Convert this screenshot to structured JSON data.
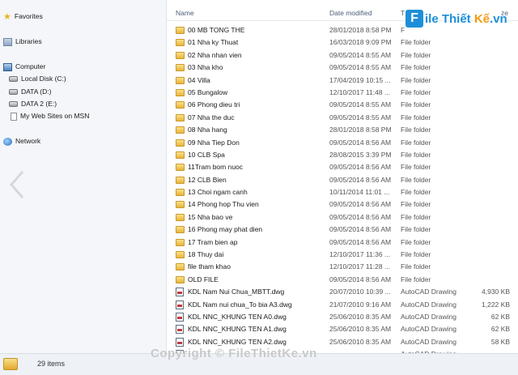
{
  "navigation": {
    "favorites": "Favorites",
    "libraries": "Libraries",
    "computer": "Computer",
    "drives": [
      "Local Disk (C:)",
      "DATA (D:)",
      "DATA 2 (E:)",
      "My Web Sites on MSN"
    ],
    "network": "Network"
  },
  "columns": {
    "name": "Name",
    "date": "Date modified",
    "type": "T",
    "size": "ze"
  },
  "files": [
    {
      "name": "00 MB TONG THE",
      "date": "28/01/2018 8:58 PM",
      "type": "F",
      "size": "",
      "kind": "folder"
    },
    {
      "name": "01 Nha ky Thuat",
      "date": "16/03/2018 9:09 PM",
      "type": "File folder",
      "size": "",
      "kind": "folder"
    },
    {
      "name": "02 Nha nhan vien",
      "date": "09/05/2014 8:55 AM",
      "type": "File folder",
      "size": "",
      "kind": "folder"
    },
    {
      "name": "03 Nha kho",
      "date": "09/05/2014 8:55 AM",
      "type": "File folder",
      "size": "",
      "kind": "folder"
    },
    {
      "name": "04 Villa",
      "date": "17/04/2019 10:15 ...",
      "type": "File folder",
      "size": "",
      "kind": "folder"
    },
    {
      "name": "05 Bungalow",
      "date": "12/10/2017 11:48 ...",
      "type": "File folder",
      "size": "",
      "kind": "folder"
    },
    {
      "name": "06 Phong dieu tri",
      "date": "09/05/2014 8:55 AM",
      "type": "File folder",
      "size": "",
      "kind": "folder"
    },
    {
      "name": "07 Nha the duc",
      "date": "09/05/2014 8:55 AM",
      "type": "File folder",
      "size": "",
      "kind": "folder"
    },
    {
      "name": "08 Nha hang",
      "date": "28/01/2018 8:58 PM",
      "type": "File folder",
      "size": "",
      "kind": "folder"
    },
    {
      "name": "09 Nha Tiep Don",
      "date": "09/05/2014 8:56 AM",
      "type": "File folder",
      "size": "",
      "kind": "folder"
    },
    {
      "name": "10 CLB Spa",
      "date": "28/08/2015 3:39 PM",
      "type": "File folder",
      "size": "",
      "kind": "folder"
    },
    {
      "name": "11Tram bom nuoc",
      "date": "09/05/2014 8:56 AM",
      "type": "File folder",
      "size": "",
      "kind": "folder"
    },
    {
      "name": "12 CLB Bien",
      "date": "09/05/2014 8:56 AM",
      "type": "File folder",
      "size": "",
      "kind": "folder"
    },
    {
      "name": "13 Choi ngam canh",
      "date": "10/11/2014 11:01 ...",
      "type": "File folder",
      "size": "",
      "kind": "folder"
    },
    {
      "name": "14 Phong hop Thu vien",
      "date": "09/05/2014 8:56 AM",
      "type": "File folder",
      "size": "",
      "kind": "folder"
    },
    {
      "name": "15 Nha bao ve",
      "date": "09/05/2014 8:56 AM",
      "type": "File folder",
      "size": "",
      "kind": "folder"
    },
    {
      "name": "16 Phong may phat dien",
      "date": "09/05/2014 8:56 AM",
      "type": "File folder",
      "size": "",
      "kind": "folder"
    },
    {
      "name": "17 Tram bien ap",
      "date": "09/05/2014 8:56 AM",
      "type": "File folder",
      "size": "",
      "kind": "folder"
    },
    {
      "name": "18 Thuy dai",
      "date": "12/10/2017 11:36 ...",
      "type": "File folder",
      "size": "",
      "kind": "folder"
    },
    {
      "name": "file tham khao",
      "date": "12/10/2017 11:28 ...",
      "type": "File folder",
      "size": "",
      "kind": "folder"
    },
    {
      "name": "OLD FILE",
      "date": "09/05/2014 8:56 AM",
      "type": "File folder",
      "size": "",
      "kind": "folder"
    },
    {
      "name": "KDL Nam Nui Chua_MBTT.dwg",
      "date": "20/07/2010 10:39 ...",
      "type": "AutoCAD Drawing",
      "size": "4,930 KB",
      "kind": "dwg"
    },
    {
      "name": "KDL Nam nui chua_To bia A3.dwg",
      "date": "21/07/2010 9:16 AM",
      "type": "AutoCAD Drawing",
      "size": "1,222 KB",
      "kind": "dwg"
    },
    {
      "name": "KDL NNC_KHUNG TEN A0.dwg",
      "date": "25/06/2010 8:35 AM",
      "type": "AutoCAD Drawing",
      "size": "62 KB",
      "kind": "dwg"
    },
    {
      "name": "KDL NNC_KHUNG TEN A1.dwg",
      "date": "25/06/2010 8:35 AM",
      "type": "AutoCAD Drawing",
      "size": "62 KB",
      "kind": "dwg"
    },
    {
      "name": "KDL NNC_KHUNG TEN A2.dwg",
      "date": "25/06/2010 8:35 AM",
      "type": "AutoCAD Drawing",
      "size": "58 KB",
      "kind": "dwg"
    },
    {
      "name": "",
      "date": "",
      "type": "AutoCAD Drawing",
      "size": "",
      "kind": "dwg"
    }
  ],
  "status": {
    "item_count": "29 items"
  },
  "watermark": "Copyright © FileThietKe.vn",
  "logo": {
    "badge": "F",
    "text_main": "ile Thiết ",
    "text_accent": "Kế",
    "text_suffix": ".vn"
  }
}
